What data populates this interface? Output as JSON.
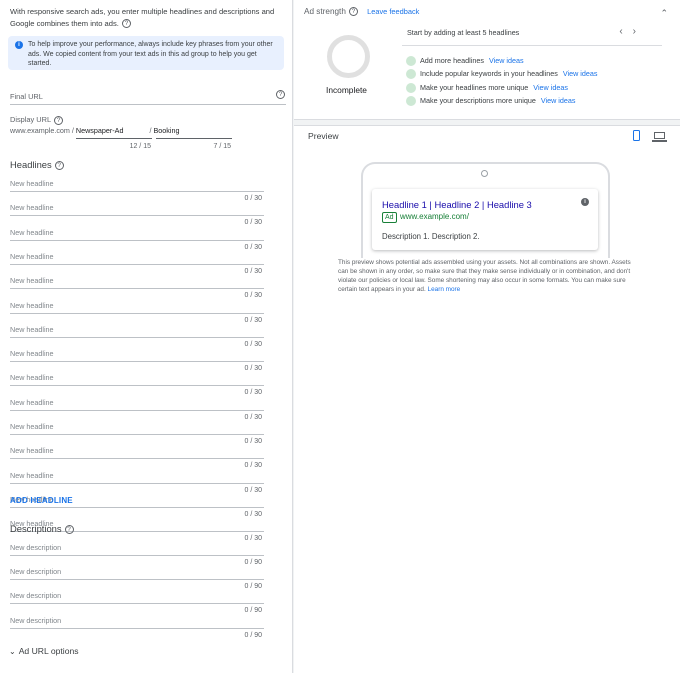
{
  "intro": {
    "text": "With responsive search ads, you enter multiple headlines and descriptions and Google combines them into ads."
  },
  "info_box": {
    "text": "To help improve your performance, always include key phrases from your other ads. We copied content from your text ads in this ad group to help you get started."
  },
  "final_url": {
    "label": "Final URL"
  },
  "display_url": {
    "label": "Display URL",
    "base": "www.example.com",
    "separator1": "/",
    "path1": "Newspaper-Ad",
    "separator2": "/",
    "path2": "Booking",
    "path1_count": "12 / 15",
    "path2_count": "7 / 15"
  },
  "headlines": {
    "title": "Headlines",
    "placeholder": "New headline",
    "count": "0 / 30",
    "items": [
      "New headline",
      "New headline",
      "New headline",
      "New headline",
      "New headline",
      "New headline",
      "New headline",
      "New headline",
      "New headline",
      "New headline",
      "New headline",
      "New headline",
      "New headline",
      "New headline",
      "New headline"
    ],
    "add_label": "ADD HEADLINE"
  },
  "descriptions": {
    "title": "Descriptions",
    "placeholder": "New description",
    "count": "0 / 90",
    "items": [
      "New description",
      "New description",
      "New description",
      "New description"
    ]
  },
  "url_options": {
    "label": "Ad URL options"
  },
  "ad_strength": {
    "title": "Ad strength",
    "feedback_link": "Leave feedback",
    "status": "Incomplete",
    "start_text": "Start by adding at least 5 headlines",
    "tips": [
      {
        "text": "Add more headlines",
        "link": "View ideas"
      },
      {
        "text": "Include popular keywords in your headlines",
        "link": "View ideas"
      },
      {
        "text": "Make your headlines more unique",
        "link": "View ideas"
      },
      {
        "text": "Make your descriptions more unique",
        "link": "View ideas"
      }
    ]
  },
  "preview": {
    "title": "Preview",
    "ad_headline": "Headline 1 | Headline 2 | Headline 3",
    "ad_badge": "Ad",
    "ad_url": "www.example.com/",
    "ad_description": "Description 1. Description 2.",
    "note": "This preview shows potential ads assembled using your assets. Not all combinations are shown. Assets can be shown in any order, so make sure that they make sense individually or in combination, and don't violate our policies or local law. Some shortening may also occur in some formats. You can make sure certain text appears in your ad.",
    "learn_more": "Learn more"
  },
  "colors": {
    "accent": "#1a73e8",
    "ad_green": "#188038",
    "tip_dot": "#cde8d4",
    "info_bg": "#e8f0fe"
  },
  "icons": {
    "help": "question-circle-icon",
    "info": "info-icon",
    "collapse": "chevron-up-icon",
    "prev": "chevron-left-icon",
    "next": "chevron-right-icon",
    "mobile": "mobile-icon",
    "desktop": "desktop-icon",
    "expand": "chevron-down-icon"
  }
}
